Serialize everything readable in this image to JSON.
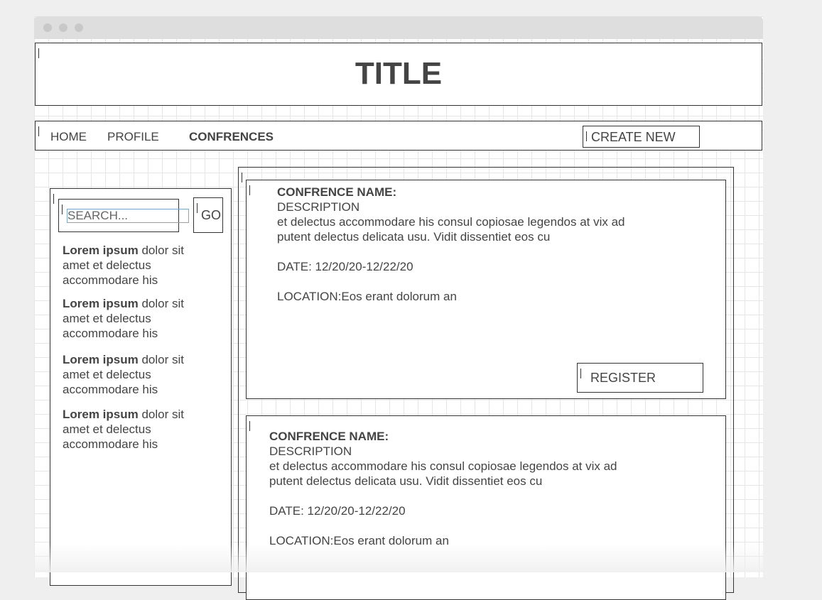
{
  "header": {
    "title": "TITLE"
  },
  "nav": {
    "items": [
      {
        "label": "HOME"
      },
      {
        "label": "PROFILE"
      },
      {
        "label": "CONFRENCES"
      }
    ],
    "create_button": "CREATE NEW"
  },
  "sidebar": {
    "search_placeholder": "SEARCH...",
    "go_button": "GO",
    "items": [
      {
        "bold": "Lorem ipsum",
        "text": " dolor sit amet et delectus accommodare his"
      },
      {
        "bold": "Lorem ipsum",
        "text": " dolor sit amet et delectus accommodare his"
      },
      {
        "bold": "Lorem ipsum",
        "text": " dolor sit amet et delectus accommodare his"
      },
      {
        "bold": "Lorem ipsum",
        "text": " dolor sit amet et delectus accommodare his"
      }
    ]
  },
  "conferences": [
    {
      "name_label": "CONFRENCE NAME:",
      "description_label": "DESCRIPTION",
      "description_line1": "et delectus accommodare his consul copiosae legendos at vix ad",
      "description_line2": "putent delectus delicata usu. Vidit dissentiet eos cu",
      "date": "DATE: 12/20/20-12/22/20",
      "location": "LOCATION:Eos erant dolorum an",
      "register_button": "REGISTER"
    },
    {
      "name_label": "CONFRENCE NAME:",
      "description_label": "DESCRIPTION",
      "description_line1": "et delectus accommodare his consul copiosae legendos at vix ad",
      "description_line2": "putent delectus delicata usu. Vidit dissentiet eos cu",
      "date": "DATE: 12/20/20-12/22/20",
      "location": "LOCATION:Eos erant dolorum an"
    }
  ]
}
